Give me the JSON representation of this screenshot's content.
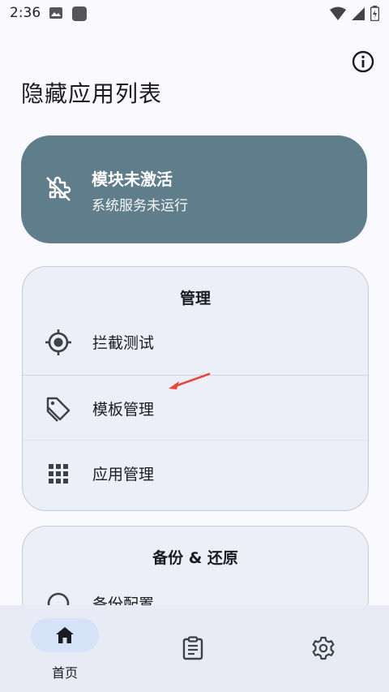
{
  "status_bar": {
    "time": "2:36"
  },
  "page_title": "隐藏应用列表",
  "status_card": {
    "title": "模块未激活",
    "subtitle": "系统服务未运行",
    "bg_color": "#607d8b"
  },
  "manage_card": {
    "title": "管理",
    "items": [
      {
        "label": "拦截测试",
        "icon": "target-icon"
      },
      {
        "label": "模板管理",
        "icon": "tag-icon"
      },
      {
        "label": "应用管理",
        "icon": "apps-grid-icon"
      }
    ]
  },
  "backup_card": {
    "title": "备份 & 还原",
    "items": [
      {
        "label": "备份配置",
        "icon": "backup-icon"
      }
    ]
  },
  "bottom_nav": {
    "items": [
      {
        "label": "首页",
        "icon": "home-icon",
        "selected": true
      },
      {
        "label": "",
        "icon": "clipboard-icon",
        "selected": false
      },
      {
        "label": "",
        "icon": "gear-icon",
        "selected": false
      }
    ]
  },
  "colors": {
    "accent_pill": "#d5e2f7",
    "annotation_arrow": "#e8473a"
  }
}
